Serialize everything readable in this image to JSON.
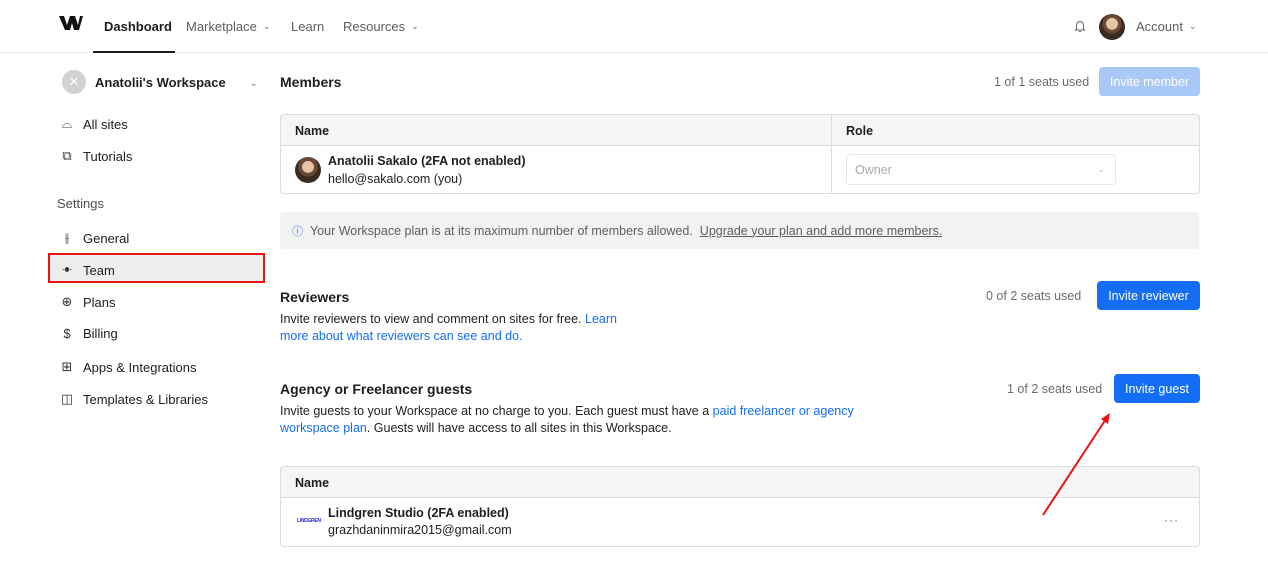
{
  "nav": {
    "items": [
      {
        "label": "Dashboard"
      },
      {
        "label": "Marketplace"
      },
      {
        "label": "Learn"
      },
      {
        "label": "Resources"
      }
    ],
    "account_label": "Account"
  },
  "sidebar": {
    "workspace_name": "Anatolii's Workspace",
    "top_items": [
      {
        "label": "All sites",
        "icon": "all-sites-icon"
      },
      {
        "label": "Tutorials",
        "icon": "tutorials-icon"
      }
    ],
    "settings_heading": "Settings",
    "settings_items": [
      {
        "label": "General",
        "icon": "sliders-icon"
      },
      {
        "label": "Team",
        "icon": "team-icon"
      },
      {
        "label": "Plans",
        "icon": "plans-icon"
      },
      {
        "label": "Billing",
        "icon": "dollar-icon"
      },
      {
        "label": "Apps & Integrations",
        "icon": "apps-icon"
      },
      {
        "label": "Templates & Libraries",
        "icon": "templates-icon"
      }
    ]
  },
  "members": {
    "title": "Members",
    "seats": "1 of 1 seats used",
    "invite_label": "Invite member",
    "col_name": "Name",
    "col_role": "Role",
    "rows": [
      {
        "name": "Anatolii Sakalo (2FA not enabled)",
        "email": "hello@sakalo.com (you)",
        "role": "Owner"
      }
    ]
  },
  "notice": {
    "text": "Your Workspace plan is at its maximum number of members allowed.",
    "link": "Upgrade your plan and add more members."
  },
  "reviewers": {
    "title": "Reviewers",
    "seats": "0 of 2 seats used",
    "invite_label": "Invite reviewer",
    "desc_text": "Invite reviewers to view and comment on sites for free.",
    "desc_link_1": "Learn",
    "desc_link_2": "more about what reviewers can see and do."
  },
  "guests": {
    "title": "Agency or Freelancer guests",
    "seats": "1 of 2 seats used",
    "invite_label": "Invite guest",
    "desc_text": "Invite guests to your Workspace at no charge to you. Each guest must have a",
    "desc_link_1": "paid freelancer or agency",
    "desc_link_2": "workspace plan",
    "desc_tail": ". Guests will have access to all sites in this Workspace.",
    "col_name": "Name",
    "rows": [
      {
        "name": "Lindgren Studio (2FA enabled)",
        "email": "grazhdaninmira2015@gmail.com",
        "logo_text": "LINDGREN",
        "more": "···"
      }
    ]
  },
  "colors": {
    "accent": "#146ef5",
    "highlight_border": "#ee1111"
  }
}
